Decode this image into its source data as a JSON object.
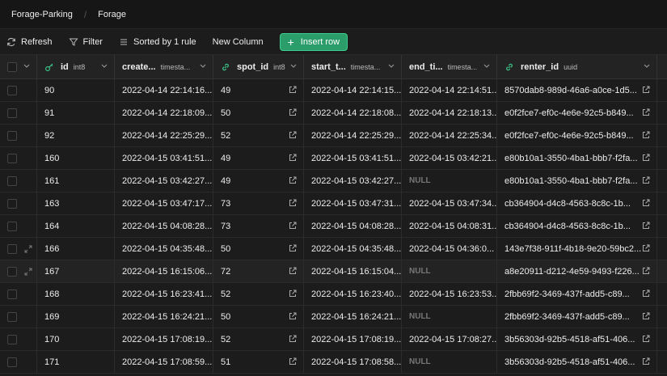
{
  "breadcrumb": {
    "project": "Forage-Parking",
    "table": "Forage"
  },
  "toolbar": {
    "refresh": "Refresh",
    "filter": "Filter",
    "sort": "Sorted by 1 rule",
    "new_column": "New Column",
    "insert_row": "Insert row"
  },
  "columns": [
    {
      "name": "id",
      "type": "int8"
    },
    {
      "name": "create...",
      "type": "timesta..."
    },
    {
      "name": "spot_id",
      "type": "int8"
    },
    {
      "name": "start_t...",
      "type": "timesta..."
    },
    {
      "name": "end_ti...",
      "type": "timesta..."
    },
    {
      "name": "renter_id",
      "type": "uuid"
    }
  ],
  "rows": [
    {
      "id": "90",
      "created": "2022-04-14 22:14:16....",
      "spot_id": "49",
      "start": "2022-04-14 22:14:15....",
      "end": "2022-04-14 22:14:51....",
      "renter": "8570dab8-989d-46a6-a0ce-1d5..."
    },
    {
      "id": "91",
      "created": "2022-04-14 22:18:09....",
      "spot_id": "50",
      "start": "2022-04-14 22:18:08....",
      "end": "2022-04-14 22:18:13....",
      "renter": "e0f2fce7-ef0c-4e6e-92c5-b849..."
    },
    {
      "id": "92",
      "created": "2022-04-14 22:25:29....",
      "spot_id": "52",
      "start": "2022-04-14 22:25:29....",
      "end": "2022-04-14 22:25:34....",
      "renter": "e0f2fce7-ef0c-4e6e-92c5-b849..."
    },
    {
      "id": "160",
      "created": "2022-04-15 03:41:51....",
      "spot_id": "49",
      "start": "2022-04-15 03:41:51....",
      "end": "2022-04-15 03:42:21....",
      "renter": "e80b10a1-3550-4ba1-bbb7-f2fa..."
    },
    {
      "id": "161",
      "created": "2022-04-15 03:42:27....",
      "spot_id": "49",
      "start": "2022-04-15 03:42:27....",
      "end": "NULL",
      "renter": "e80b10a1-3550-4ba1-bbb7-f2fa..."
    },
    {
      "id": "163",
      "created": "2022-04-15 03:47:17....",
      "spot_id": "73",
      "start": "2022-04-15 03:47:31....",
      "end": "2022-04-15 03:47:34....",
      "renter": "cb364904-d4c8-4563-8c8c-1b..."
    },
    {
      "id": "164",
      "created": "2022-04-15 04:08:28....",
      "spot_id": "73",
      "start": "2022-04-15 04:08:28....",
      "end": "2022-04-15 04:08:31....",
      "renter": "cb364904-d4c8-4563-8c8c-1b..."
    },
    {
      "id": "166",
      "created": "2022-04-15 04:35:48....",
      "spot_id": "50",
      "start": "2022-04-15 04:35:48....",
      "end": "2022-04-15 04:36:0...",
      "renter": "143e7f38-911f-4b18-9e20-59bc2..."
    },
    {
      "id": "167",
      "created": "2022-04-15 16:15:06....",
      "spot_id": "72",
      "start": "2022-04-15 16:15:04....",
      "end": "NULL",
      "renter": "a8e20911-d212-4e59-9493-f226..."
    },
    {
      "id": "168",
      "created": "2022-04-15 16:23:41....",
      "spot_id": "52",
      "start": "2022-04-15 16:23:40....",
      "end": "2022-04-15 16:23:53....",
      "renter": "2fbb69f2-3469-437f-add5-c89..."
    },
    {
      "id": "169",
      "created": "2022-04-15 16:24:21....",
      "spot_id": "50",
      "start": "2022-04-15 16:24:21....",
      "end": "NULL",
      "renter": "2fbb69f2-3469-437f-add5-c89..."
    },
    {
      "id": "170",
      "created": "2022-04-15 17:08:19....",
      "spot_id": "52",
      "start": "2022-04-15 17:08:19....",
      "end": "2022-04-15 17:08:27....",
      "renter": "3b56303d-92b5-4518-af51-406..."
    },
    {
      "id": "171",
      "created": "2022-04-15 17:08:59....",
      "spot_id": "51",
      "start": "2022-04-15 17:08:58....",
      "end": "NULL",
      "renter": "3b56303d-92b5-4518-af51-406..."
    }
  ],
  "highlighted_row": 8,
  "colors": {
    "accent": "#3ecf8e",
    "background": "#1c1c1c"
  }
}
